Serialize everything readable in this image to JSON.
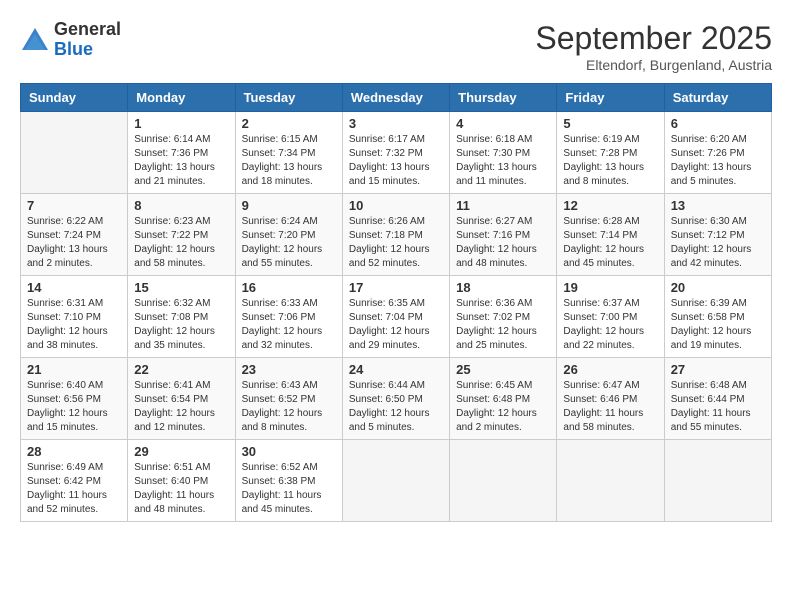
{
  "header": {
    "logo": {
      "general": "General",
      "blue": "Blue"
    },
    "title": "September 2025",
    "subtitle": "Eltendorf, Burgenland, Austria"
  },
  "calendar": {
    "days_of_week": [
      "Sunday",
      "Monday",
      "Tuesday",
      "Wednesday",
      "Thursday",
      "Friday",
      "Saturday"
    ],
    "weeks": [
      [
        {
          "day": "",
          "info": ""
        },
        {
          "day": "1",
          "info": "Sunrise: 6:14 AM\nSunset: 7:36 PM\nDaylight: 13 hours\nand 21 minutes."
        },
        {
          "day": "2",
          "info": "Sunrise: 6:15 AM\nSunset: 7:34 PM\nDaylight: 13 hours\nand 18 minutes."
        },
        {
          "day": "3",
          "info": "Sunrise: 6:17 AM\nSunset: 7:32 PM\nDaylight: 13 hours\nand 15 minutes."
        },
        {
          "day": "4",
          "info": "Sunrise: 6:18 AM\nSunset: 7:30 PM\nDaylight: 13 hours\nand 11 minutes."
        },
        {
          "day": "5",
          "info": "Sunrise: 6:19 AM\nSunset: 7:28 PM\nDaylight: 13 hours\nand 8 minutes."
        },
        {
          "day": "6",
          "info": "Sunrise: 6:20 AM\nSunset: 7:26 PM\nDaylight: 13 hours\nand 5 minutes."
        }
      ],
      [
        {
          "day": "7",
          "info": "Sunrise: 6:22 AM\nSunset: 7:24 PM\nDaylight: 13 hours\nand 2 minutes."
        },
        {
          "day": "8",
          "info": "Sunrise: 6:23 AM\nSunset: 7:22 PM\nDaylight: 12 hours\nand 58 minutes."
        },
        {
          "day": "9",
          "info": "Sunrise: 6:24 AM\nSunset: 7:20 PM\nDaylight: 12 hours\nand 55 minutes."
        },
        {
          "day": "10",
          "info": "Sunrise: 6:26 AM\nSunset: 7:18 PM\nDaylight: 12 hours\nand 52 minutes."
        },
        {
          "day": "11",
          "info": "Sunrise: 6:27 AM\nSunset: 7:16 PM\nDaylight: 12 hours\nand 48 minutes."
        },
        {
          "day": "12",
          "info": "Sunrise: 6:28 AM\nSunset: 7:14 PM\nDaylight: 12 hours\nand 45 minutes."
        },
        {
          "day": "13",
          "info": "Sunrise: 6:30 AM\nSunset: 7:12 PM\nDaylight: 12 hours\nand 42 minutes."
        }
      ],
      [
        {
          "day": "14",
          "info": "Sunrise: 6:31 AM\nSunset: 7:10 PM\nDaylight: 12 hours\nand 38 minutes."
        },
        {
          "day": "15",
          "info": "Sunrise: 6:32 AM\nSunset: 7:08 PM\nDaylight: 12 hours\nand 35 minutes."
        },
        {
          "day": "16",
          "info": "Sunrise: 6:33 AM\nSunset: 7:06 PM\nDaylight: 12 hours\nand 32 minutes."
        },
        {
          "day": "17",
          "info": "Sunrise: 6:35 AM\nSunset: 7:04 PM\nDaylight: 12 hours\nand 29 minutes."
        },
        {
          "day": "18",
          "info": "Sunrise: 6:36 AM\nSunset: 7:02 PM\nDaylight: 12 hours\nand 25 minutes."
        },
        {
          "day": "19",
          "info": "Sunrise: 6:37 AM\nSunset: 7:00 PM\nDaylight: 12 hours\nand 22 minutes."
        },
        {
          "day": "20",
          "info": "Sunrise: 6:39 AM\nSunset: 6:58 PM\nDaylight: 12 hours\nand 19 minutes."
        }
      ],
      [
        {
          "day": "21",
          "info": "Sunrise: 6:40 AM\nSunset: 6:56 PM\nDaylight: 12 hours\nand 15 minutes."
        },
        {
          "day": "22",
          "info": "Sunrise: 6:41 AM\nSunset: 6:54 PM\nDaylight: 12 hours\nand 12 minutes."
        },
        {
          "day": "23",
          "info": "Sunrise: 6:43 AM\nSunset: 6:52 PM\nDaylight: 12 hours\nand 8 minutes."
        },
        {
          "day": "24",
          "info": "Sunrise: 6:44 AM\nSunset: 6:50 PM\nDaylight: 12 hours\nand 5 minutes."
        },
        {
          "day": "25",
          "info": "Sunrise: 6:45 AM\nSunset: 6:48 PM\nDaylight: 12 hours\nand 2 minutes."
        },
        {
          "day": "26",
          "info": "Sunrise: 6:47 AM\nSunset: 6:46 PM\nDaylight: 11 hours\nand 58 minutes."
        },
        {
          "day": "27",
          "info": "Sunrise: 6:48 AM\nSunset: 6:44 PM\nDaylight: 11 hours\nand 55 minutes."
        }
      ],
      [
        {
          "day": "28",
          "info": "Sunrise: 6:49 AM\nSunset: 6:42 PM\nDaylight: 11 hours\nand 52 minutes."
        },
        {
          "day": "29",
          "info": "Sunrise: 6:51 AM\nSunset: 6:40 PM\nDaylight: 11 hours\nand 48 minutes."
        },
        {
          "day": "30",
          "info": "Sunrise: 6:52 AM\nSunset: 6:38 PM\nDaylight: 11 hours\nand 45 minutes."
        },
        {
          "day": "",
          "info": ""
        },
        {
          "day": "",
          "info": ""
        },
        {
          "day": "",
          "info": ""
        },
        {
          "day": "",
          "info": ""
        }
      ]
    ]
  }
}
